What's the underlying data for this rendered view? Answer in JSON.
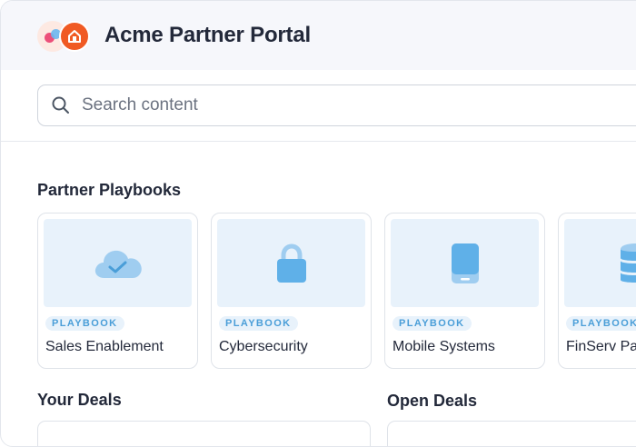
{
  "header": {
    "title": "Acme Partner Portal"
  },
  "search": {
    "placeholder": "Search content"
  },
  "playbooks": {
    "heading": "Partner Playbooks",
    "items": [
      {
        "badge": "PLAYBOOK",
        "name": "Sales Enablement",
        "icon": "cloud-check-icon"
      },
      {
        "badge": "PLAYBOOK",
        "name": "Cybersecurity",
        "icon": "lock-icon"
      },
      {
        "badge": "PLAYBOOK",
        "name": "Mobile Systems",
        "icon": "tablet-icon"
      },
      {
        "badge": "PLAYBOOK",
        "name": "FinServ Pa",
        "icon": "database-icon"
      }
    ]
  },
  "deals": {
    "your_heading": "Your Deals",
    "open_heading": "Open Deals"
  },
  "colors": {
    "accent": "#4a9ed8",
    "thumb_bg": "#e8f2fb",
    "brand_orange": "#f05a23"
  }
}
